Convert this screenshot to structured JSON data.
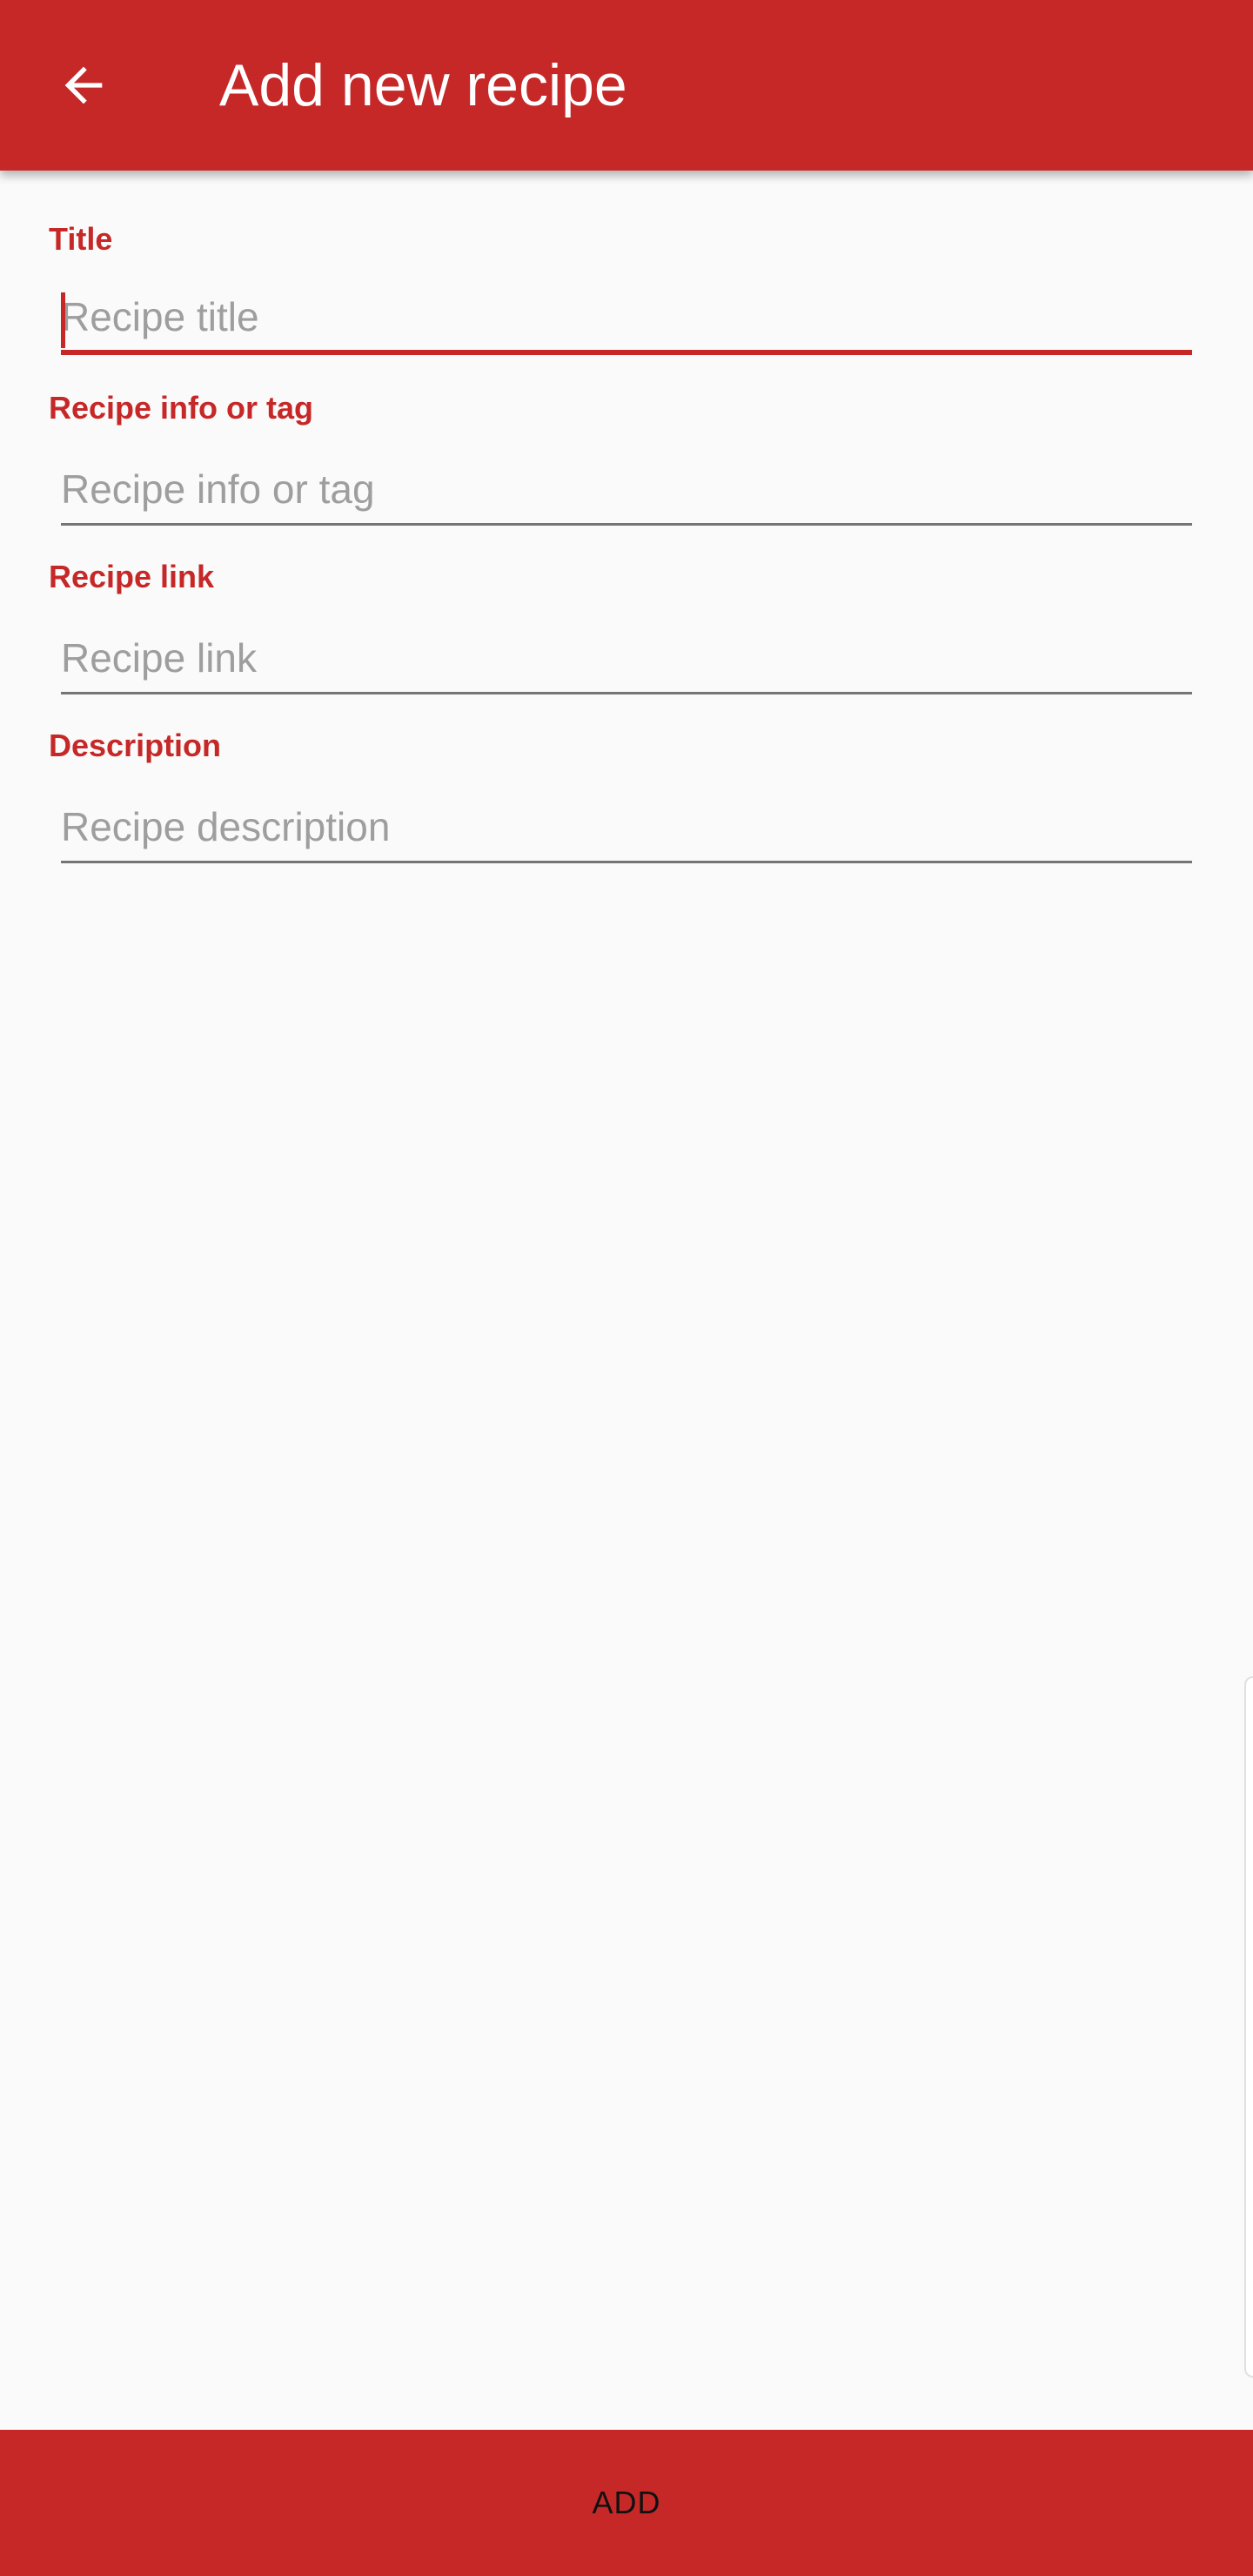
{
  "app_bar": {
    "back_icon": "arrow-left-icon",
    "title": "Add new recipe",
    "background_color": "#c62828"
  },
  "form": {
    "fields": [
      {
        "label": "Title",
        "value": "",
        "placeholder": "Recipe title",
        "focused": true
      },
      {
        "label": "Recipe info or tag",
        "value": "",
        "placeholder": "Recipe info or tag",
        "focused": false
      },
      {
        "label": "Recipe link",
        "value": "",
        "placeholder": "Recipe link",
        "focused": false
      },
      {
        "label": "Description",
        "value": "",
        "placeholder": "Recipe description",
        "focused": false
      }
    ]
  },
  "footer": {
    "add_label": "ADD"
  },
  "colors": {
    "accent": "#c62828",
    "background": "#fafafa",
    "placeholder": "#9e9e9e",
    "underline": "#757575"
  }
}
